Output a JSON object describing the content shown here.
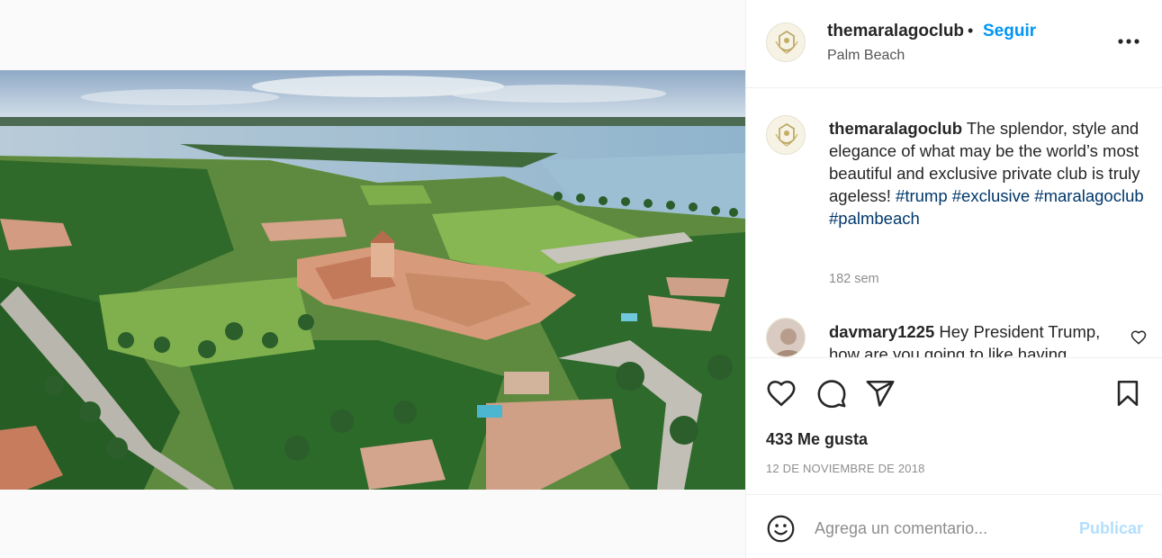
{
  "post": {
    "username": "themaralagoclub",
    "follow_label": "Seguir",
    "location": "Palm Beach",
    "image_icon": "aerial-photo-palm-beach-estate"
  },
  "caption": {
    "username": "themaralagoclub",
    "text": "The splendor, style and elegance of what may be the world’s most beautiful and exclusive private club is truly ageless!",
    "hashtags": [
      "#trump",
      "#exclusive",
      "#maralagoclub",
      "#palmbeach"
    ],
    "time": "182 sem"
  },
  "comment": {
    "username": "davmary1225",
    "text": "Hey President Trump, how are you going to like having"
  },
  "actions": {
    "like_icon": "heart-icon",
    "comment_icon": "speech-bubble-icon",
    "share_icon": "paper-plane-icon",
    "save_icon": "bookmark-icon"
  },
  "likes": "433 Me gusta",
  "date": "12 DE NOVIEMBRE DE 2018",
  "composer": {
    "placeholder": "Agrega un comentario...",
    "publish_label": "Publicar"
  },
  "colors": {
    "accent": "#0095f6",
    "hashtag": "#00376b",
    "muted": "#8e8e8e",
    "publish_disabled": "#b2dffc"
  }
}
